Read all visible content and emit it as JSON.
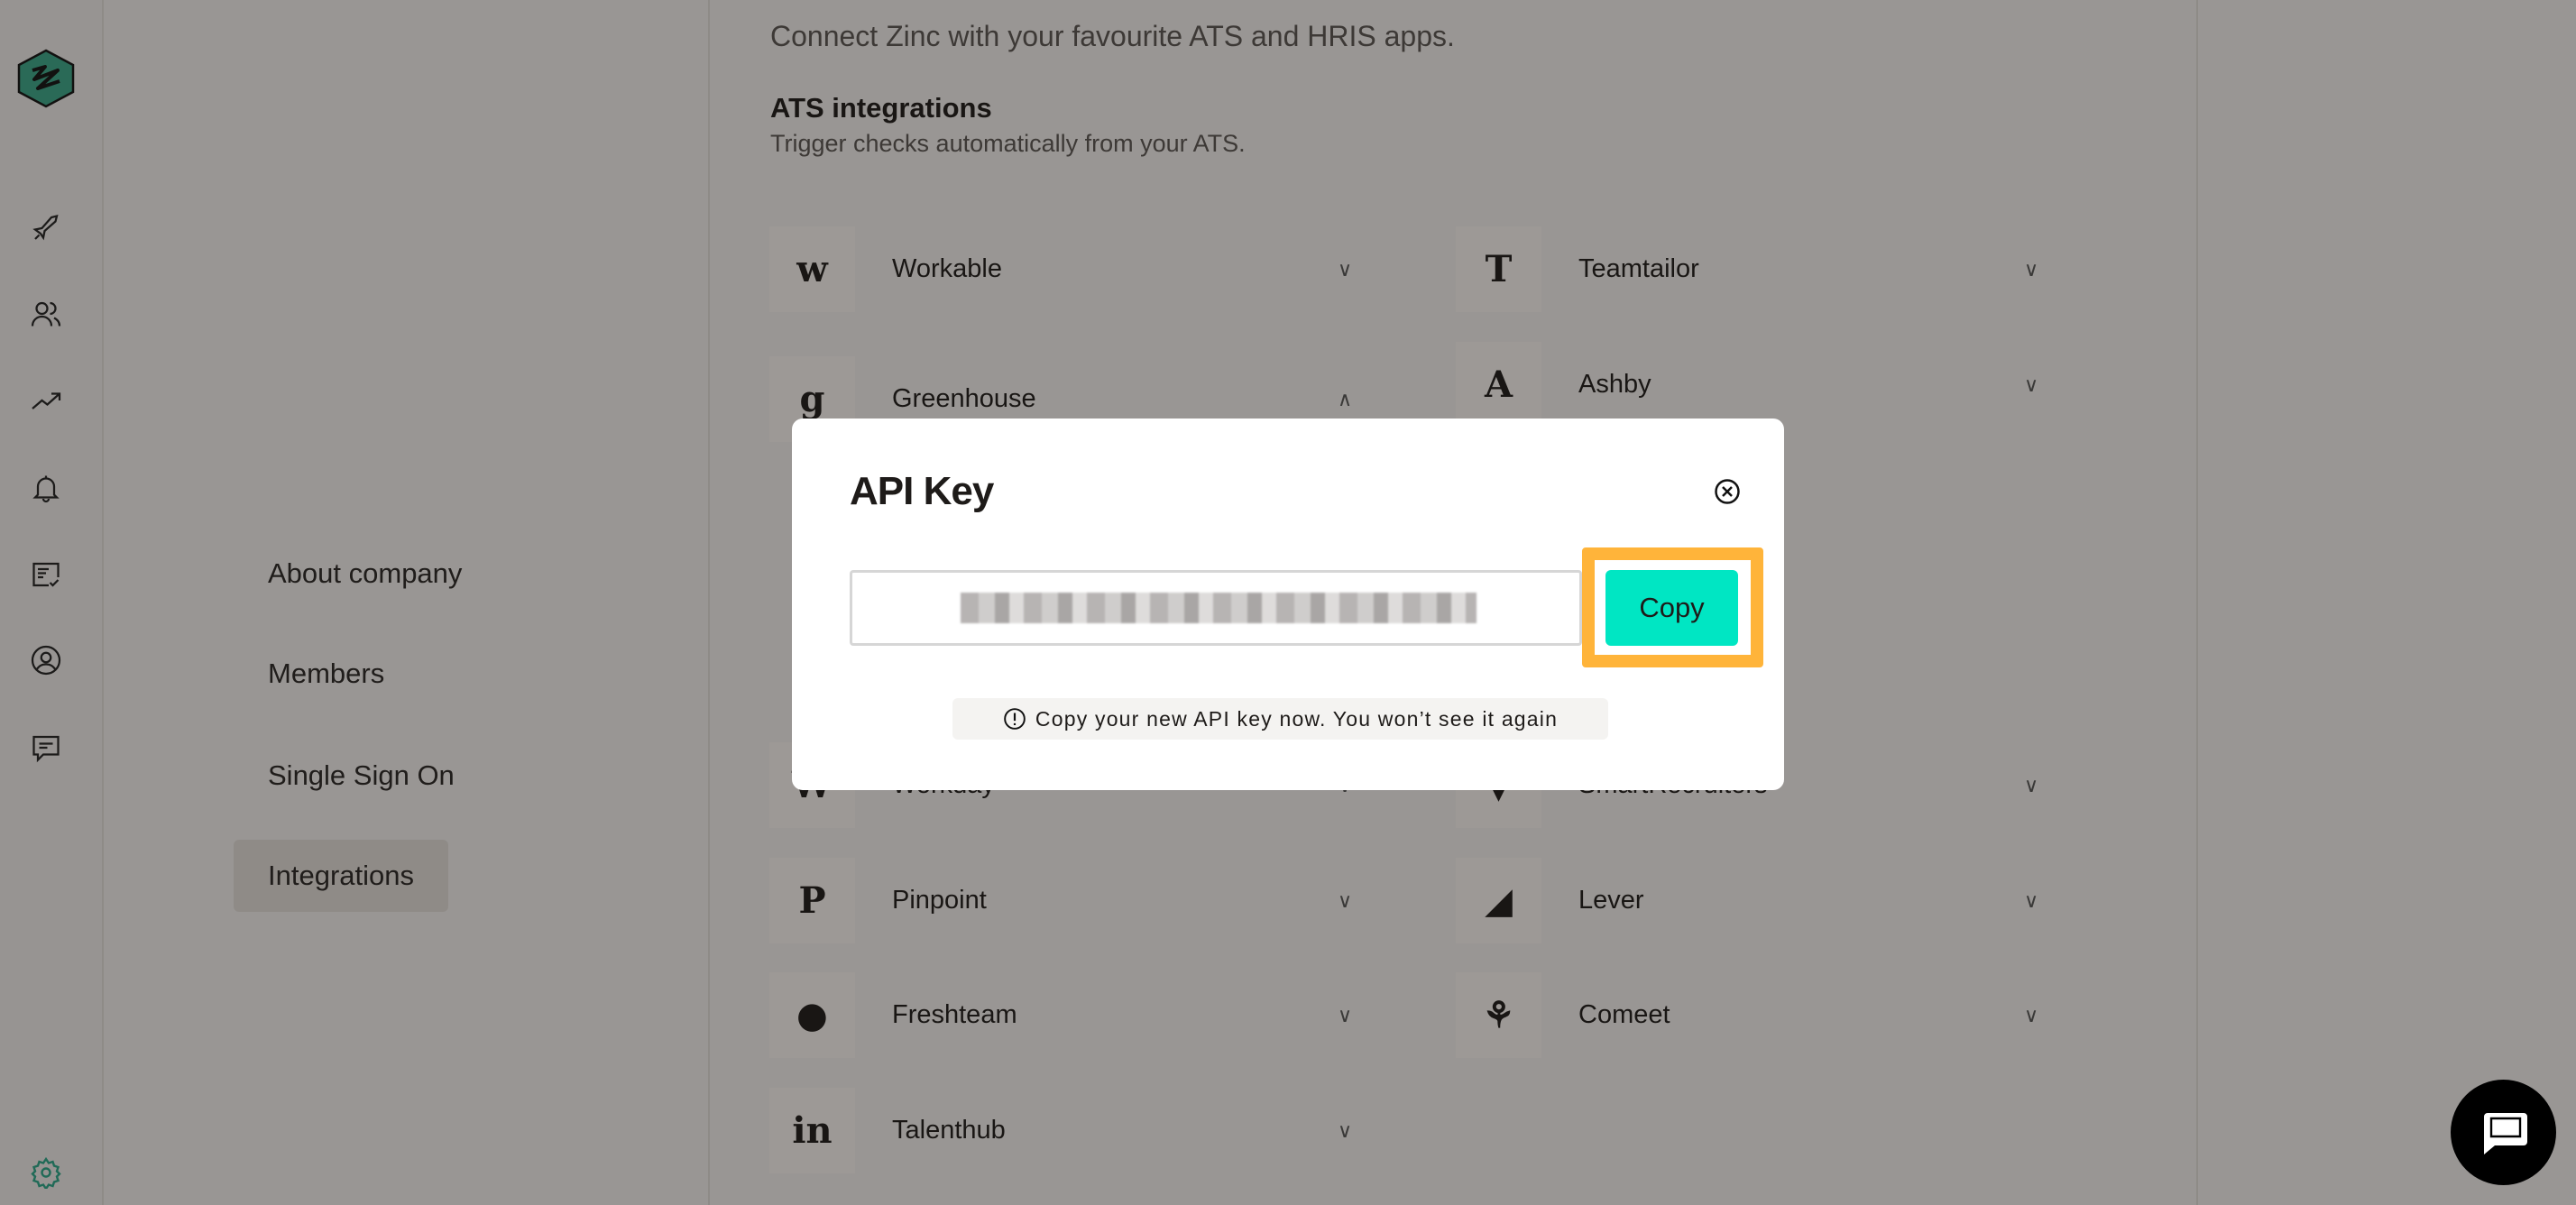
{
  "colors": {
    "accent": "#00e6c3",
    "highlight": "#ffb43a",
    "logo": "#3aa88a"
  },
  "rail": {
    "icons": [
      "rocket-icon",
      "users-icon",
      "trending-up-icon",
      "bell-icon",
      "checklist-icon",
      "user-circle-icon",
      "message-icon",
      "gear-icon"
    ]
  },
  "nav": {
    "items": [
      {
        "label": "About company"
      },
      {
        "label": "Members"
      },
      {
        "label": "Single Sign On"
      },
      {
        "label": "Integrations",
        "active": true
      }
    ]
  },
  "main": {
    "subtitle": "Connect Zinc with your favourite ATS and HRIS apps.",
    "ats_title": "ATS integrations",
    "ats_subtitle": "Trigger checks automatically from your ATS.",
    "integrations": [
      {
        "name": "Workable",
        "glyph": "w",
        "expanded": false
      },
      {
        "name": "Teamtailor",
        "glyph": "T",
        "expanded": false
      },
      {
        "name": "Greenhouse",
        "glyph": "g",
        "expanded": true
      },
      {
        "name": "Ashby",
        "glyph": "A",
        "expanded": false
      },
      {
        "name": "Workday",
        "glyph": "W",
        "expanded": false
      },
      {
        "name": "SmartRecruiters",
        "glyph": "▼",
        "expanded": false
      },
      {
        "name": "Pinpoint",
        "glyph": "P",
        "expanded": false
      },
      {
        "name": "Lever",
        "glyph": "◢",
        "expanded": false
      },
      {
        "name": "Freshteam",
        "glyph": "●",
        "expanded": false
      },
      {
        "name": "Comeet",
        "glyph": "⚘",
        "expanded": false
      },
      {
        "name": "Talenthub",
        "glyph": "in",
        "expanded": false
      }
    ]
  },
  "modal": {
    "title": "API Key",
    "copy_label": "Copy",
    "notice": "Copy your new API key now. You won’t see it again"
  }
}
